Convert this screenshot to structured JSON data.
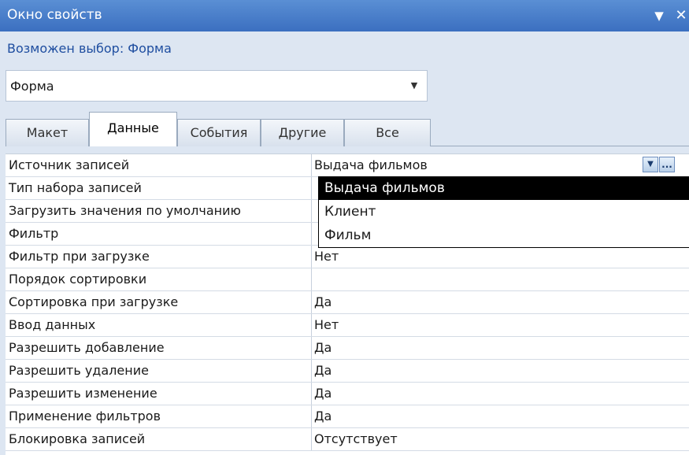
{
  "titlebar": {
    "title": "Окно свойств",
    "menu_glyph": "▼",
    "close_glyph": "✕"
  },
  "selection": {
    "label": "Возможен выбор:  Форма"
  },
  "object_combo": {
    "value": "Форма",
    "arrow_glyph": "▼"
  },
  "tabs": [
    {
      "label": "Макет",
      "active": false
    },
    {
      "label": "Данные",
      "active": true
    },
    {
      "label": "События",
      "active": false
    },
    {
      "label": "Другие",
      "active": false
    },
    {
      "label": "Все",
      "active": false
    }
  ],
  "properties": [
    {
      "name": "Источник записей",
      "value": "Выдача фильмов"
    },
    {
      "name": "Тип набора записей",
      "value": ""
    },
    {
      "name": "Загрузить значения по умолчанию",
      "value": ""
    },
    {
      "name": "Фильтр",
      "value": ""
    },
    {
      "name": "Фильтр при загрузке",
      "value": "Нет"
    },
    {
      "name": "Порядок сортировки",
      "value": ""
    },
    {
      "name": "Сортировка при загрузке",
      "value": "Да"
    },
    {
      "name": "Ввод данных",
      "value": "Нет"
    },
    {
      "name": "Разрешить добавление",
      "value": "Да"
    },
    {
      "name": "Разрешить удаление",
      "value": "Да"
    },
    {
      "name": "Разрешить изменение",
      "value": "Да"
    },
    {
      "name": "Применение фильтров",
      "value": "Да"
    },
    {
      "name": "Блокировка записей",
      "value": "Отсутствует"
    }
  ],
  "record_source_dropdown": {
    "open_button_glyph": "▼",
    "build_button_glyph": "...",
    "options": [
      {
        "label": "Выдача фильмов",
        "selected": true
      },
      {
        "label": "Клиент",
        "selected": false
      },
      {
        "label": "Фильм",
        "selected": false
      }
    ]
  }
}
